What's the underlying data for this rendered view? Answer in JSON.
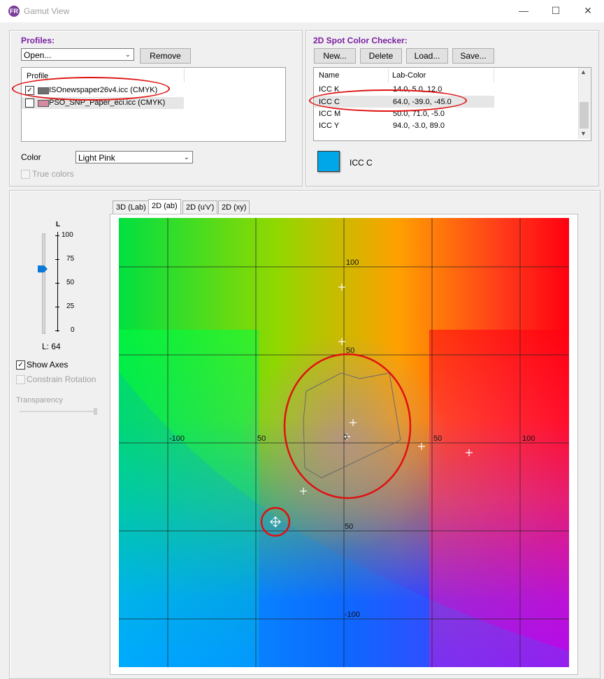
{
  "window": {
    "title": "Gamut View",
    "minimize": "—",
    "maximize": "☐",
    "close": "✕"
  },
  "profiles": {
    "title": "Profiles:",
    "open_combo": "Open...",
    "remove_button": "Remove",
    "list_header": "Profile",
    "items": [
      {
        "name": "ISOnewspaper26v4.icc (CMYK)",
        "checked": true,
        "color": "#707070"
      },
      {
        "name": "PSO_SNP_Paper_eci.icc (CMYK)",
        "checked": false,
        "color": "#d48aa0"
      }
    ],
    "color_label": "Color",
    "color_value": "Light Pink",
    "true_colors_label": "True colors"
  },
  "spot_checker": {
    "title": "2D Spot Color Checker:",
    "buttons": {
      "new": "New...",
      "delete": "Delete",
      "load": "Load...",
      "save": "Save..."
    },
    "columns": {
      "name": "Name",
      "lab": "Lab-Color"
    },
    "rows": [
      {
        "name": "ICC K",
        "lab": "14.0, 5.0, 12.0"
      },
      {
        "name": "ICC C",
        "lab": "64.0, -39.0, -45.0"
      },
      {
        "name": "ICC M",
        "lab": "50.0, 71.0, -5.0"
      },
      {
        "name": "ICC Y",
        "lab": "94.0, -3.0, 89.0"
      }
    ],
    "selected_index": 1,
    "selected_label": "ICC C",
    "selected_color": "#00a7e8"
  },
  "lightness": {
    "axis_label": "L",
    "ticks": [
      "100",
      "75",
      "50",
      "25",
      "0"
    ],
    "value_label": "L: 64",
    "value": 64
  },
  "options": {
    "show_axes": "Show Axes",
    "show_axes_checked": true,
    "constrain_rotation": "Constrain Rotation",
    "transparency": "Transparency"
  },
  "tabs": [
    {
      "label": "3D (Lab)",
      "active": false
    },
    {
      "label": "2D (ab)",
      "active": true
    },
    {
      "label": "2D (u'v')",
      "active": false
    },
    {
      "label": "2D (xy)",
      "active": false
    }
  ],
  "plot": {
    "axis_labels": {
      "top_100": "100",
      "top_50": "50",
      "left_100": "-100",
      "left_50": "50",
      "origin": "0",
      "right_50": "50",
      "right_100": "100",
      "bottom_50": "50",
      "bottom_100": "-100"
    },
    "grid_lines": 5
  }
}
